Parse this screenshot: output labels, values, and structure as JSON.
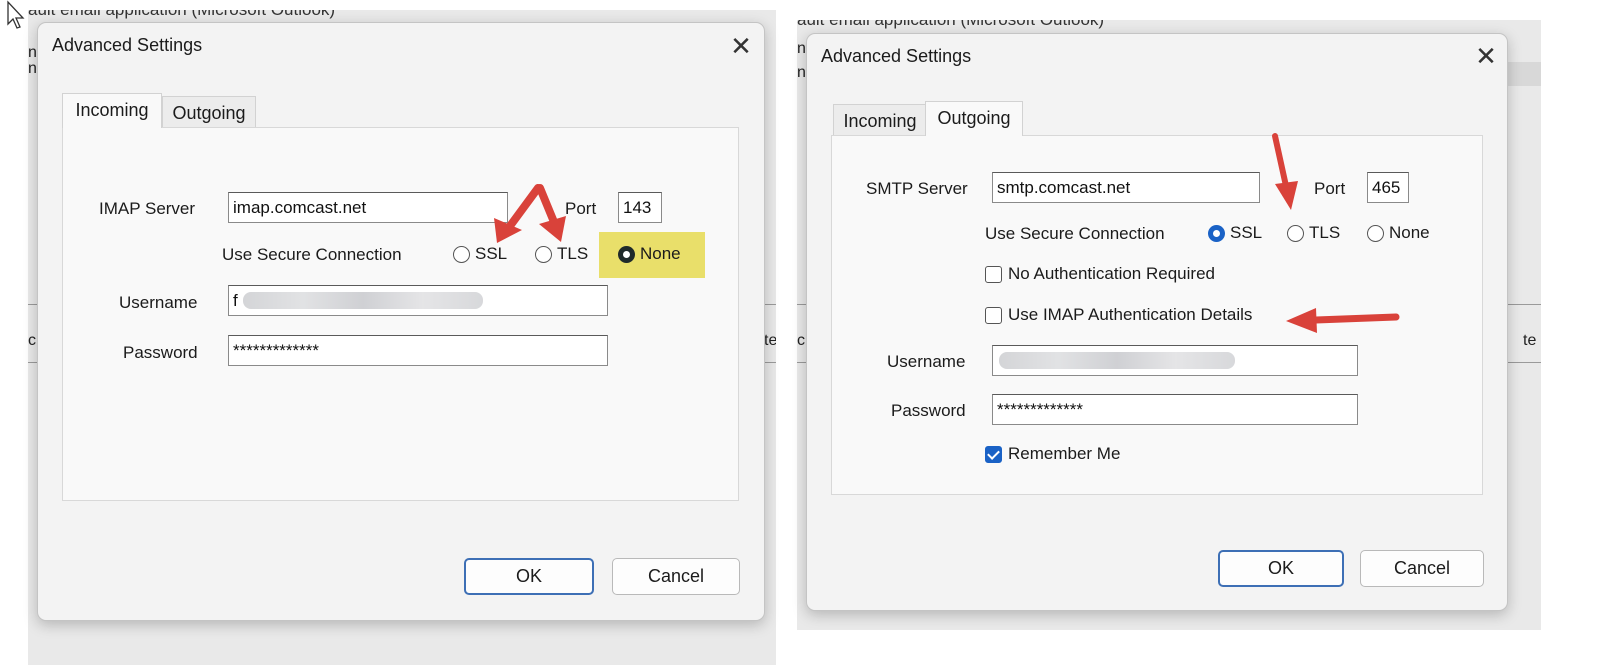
{
  "background": {
    "left_header": "ault email application (Microsoft Outlook)",
    "right_header": "ault email application (Microsoft Outlook)",
    "left_edge_a": "n",
    "left_edge_b": "n",
    "left_edge_c": "c",
    "left_edge_d": "te",
    "right_edge_a": "n",
    "right_edge_b": "n",
    "right_edge_c": "c",
    "right_edge_d": "te"
  },
  "left_dialog": {
    "title": "Advanced Settings",
    "close_glyph": "✕",
    "tabs": [
      {
        "label": "Incoming",
        "active": true
      },
      {
        "label": "Outgoing",
        "active": false
      }
    ],
    "server_label": "IMAP Server",
    "server_value": "imap.comcast.net",
    "port_label": "Port",
    "port_value": "143",
    "secure_label": "Use Secure Connection",
    "radios": [
      {
        "label": "SSL",
        "selected": false
      },
      {
        "label": "TLS",
        "selected": false
      },
      {
        "label": "None",
        "selected": true,
        "highlighted": true
      }
    ],
    "username_label": "Username",
    "username_visible_prefix": "f",
    "password_label": "Password",
    "password_value": "*************",
    "ok_label": "OK",
    "cancel_label": "Cancel"
  },
  "right_dialog": {
    "title": "Advanced Settings",
    "close_glyph": "✕",
    "tabs": [
      {
        "label": "Incoming",
        "active": false
      },
      {
        "label": "Outgoing",
        "active": true
      }
    ],
    "server_label": "SMTP Server",
    "server_value": "smtp.comcast.net",
    "port_label": "Port",
    "port_value": "465",
    "secure_label": "Use Secure Connection",
    "radios": [
      {
        "label": "SSL",
        "selected": true
      },
      {
        "label": "TLS",
        "selected": false
      },
      {
        "label": "None",
        "selected": false
      }
    ],
    "no_auth_label": "No Authentication Required",
    "no_auth_checked": false,
    "use_imap_label": "Use IMAP Authentication Details",
    "use_imap_checked": false,
    "username_label": "Username",
    "password_label": "Password",
    "password_value": "*************",
    "remember_label": "Remember Me",
    "remember_checked": true,
    "ok_label": "OK",
    "cancel_label": "Cancel"
  },
  "colors": {
    "annotation_arrow": "#d9423a",
    "highlight": "#e9df6a",
    "accent": "#1a62c6"
  }
}
